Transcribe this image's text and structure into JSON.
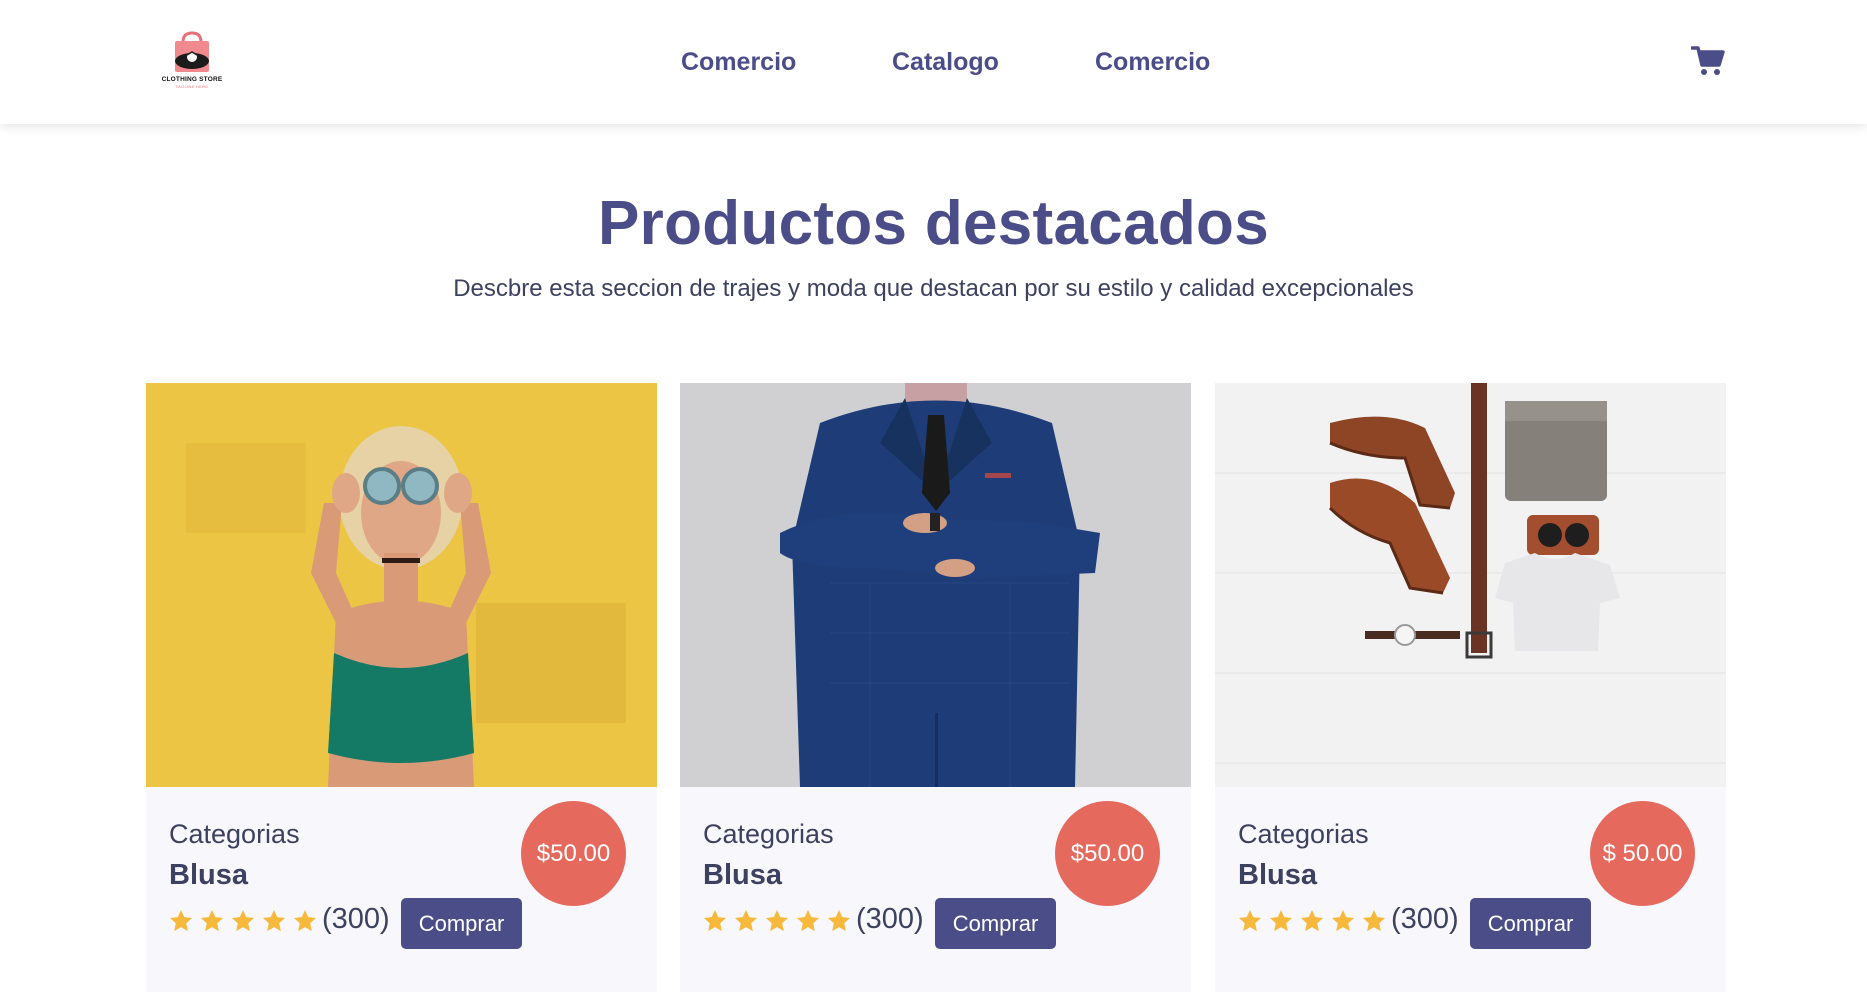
{
  "header": {
    "logo": {
      "name": "CLOTHING STORE",
      "tagline": "TAGLINE HERE"
    },
    "nav": [
      {
        "label": "Comercio"
      },
      {
        "label": "Catalogo"
      },
      {
        "label": "Comercio"
      }
    ],
    "cart_icon": "shopping-cart-icon"
  },
  "hero": {
    "title": "Productos destacados",
    "subtitle": "Descbre esta seccion de trajes y moda que destacan por su estilo y calidad excepcionales"
  },
  "products": [
    {
      "image": "woman-yellow-wall-photo",
      "category": "Categorias",
      "name": "Blusa",
      "rating": 5,
      "reviews": "(300)",
      "button": "Comprar",
      "price": "$50.00"
    },
    {
      "image": "man-blue-suit-photo",
      "category": "Categorias",
      "name": "Blusa",
      "rating": 5,
      "reviews": "(300)",
      "button": "Comprar",
      "price": "$50.00"
    },
    {
      "image": "flatlay-boots-accessories-photo",
      "category": "Categorias",
      "name": "Blusa",
      "rating": 5,
      "reviews": "(300)",
      "button": "Comprar",
      "price": "$ 50.00"
    }
  ],
  "colors": {
    "primary": "#4a4d87",
    "price_badge": "#e5695c",
    "star": "#f6b93b",
    "card_bg": "#f7f7fc"
  }
}
